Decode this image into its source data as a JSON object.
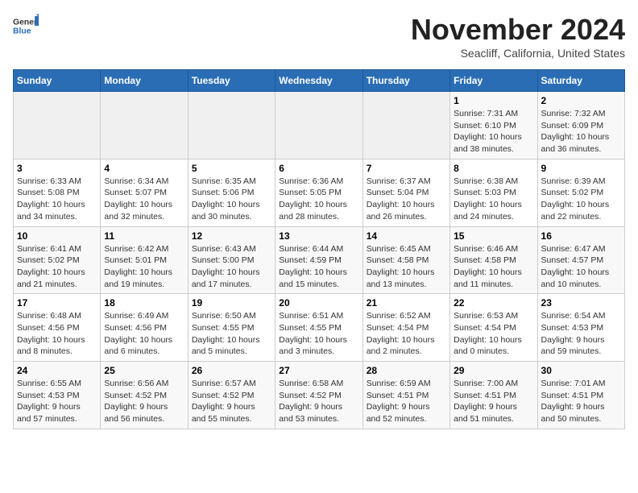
{
  "header": {
    "logo_general": "General",
    "logo_blue": "Blue",
    "month_title": "November 2024",
    "location": "Seacliff, California, United States"
  },
  "weekdays": [
    "Sunday",
    "Monday",
    "Tuesday",
    "Wednesday",
    "Thursday",
    "Friday",
    "Saturday"
  ],
  "weeks": [
    [
      {
        "day": "",
        "info": ""
      },
      {
        "day": "",
        "info": ""
      },
      {
        "day": "",
        "info": ""
      },
      {
        "day": "",
        "info": ""
      },
      {
        "day": "",
        "info": ""
      },
      {
        "day": "1",
        "info": "Sunrise: 7:31 AM\nSunset: 6:10 PM\nDaylight: 10 hours\nand 38 minutes."
      },
      {
        "day": "2",
        "info": "Sunrise: 7:32 AM\nSunset: 6:09 PM\nDaylight: 10 hours\nand 36 minutes."
      }
    ],
    [
      {
        "day": "3",
        "info": "Sunrise: 6:33 AM\nSunset: 5:08 PM\nDaylight: 10 hours\nand 34 minutes."
      },
      {
        "day": "4",
        "info": "Sunrise: 6:34 AM\nSunset: 5:07 PM\nDaylight: 10 hours\nand 32 minutes."
      },
      {
        "day": "5",
        "info": "Sunrise: 6:35 AM\nSunset: 5:06 PM\nDaylight: 10 hours\nand 30 minutes."
      },
      {
        "day": "6",
        "info": "Sunrise: 6:36 AM\nSunset: 5:05 PM\nDaylight: 10 hours\nand 28 minutes."
      },
      {
        "day": "7",
        "info": "Sunrise: 6:37 AM\nSunset: 5:04 PM\nDaylight: 10 hours\nand 26 minutes."
      },
      {
        "day": "8",
        "info": "Sunrise: 6:38 AM\nSunset: 5:03 PM\nDaylight: 10 hours\nand 24 minutes."
      },
      {
        "day": "9",
        "info": "Sunrise: 6:39 AM\nSunset: 5:02 PM\nDaylight: 10 hours\nand 22 minutes."
      }
    ],
    [
      {
        "day": "10",
        "info": "Sunrise: 6:41 AM\nSunset: 5:02 PM\nDaylight: 10 hours\nand 21 minutes."
      },
      {
        "day": "11",
        "info": "Sunrise: 6:42 AM\nSunset: 5:01 PM\nDaylight: 10 hours\nand 19 minutes."
      },
      {
        "day": "12",
        "info": "Sunrise: 6:43 AM\nSunset: 5:00 PM\nDaylight: 10 hours\nand 17 minutes."
      },
      {
        "day": "13",
        "info": "Sunrise: 6:44 AM\nSunset: 4:59 PM\nDaylight: 10 hours\nand 15 minutes."
      },
      {
        "day": "14",
        "info": "Sunrise: 6:45 AM\nSunset: 4:58 PM\nDaylight: 10 hours\nand 13 minutes."
      },
      {
        "day": "15",
        "info": "Sunrise: 6:46 AM\nSunset: 4:58 PM\nDaylight: 10 hours\nand 11 minutes."
      },
      {
        "day": "16",
        "info": "Sunrise: 6:47 AM\nSunset: 4:57 PM\nDaylight: 10 hours\nand 10 minutes."
      }
    ],
    [
      {
        "day": "17",
        "info": "Sunrise: 6:48 AM\nSunset: 4:56 PM\nDaylight: 10 hours\nand 8 minutes."
      },
      {
        "day": "18",
        "info": "Sunrise: 6:49 AM\nSunset: 4:56 PM\nDaylight: 10 hours\nand 6 minutes."
      },
      {
        "day": "19",
        "info": "Sunrise: 6:50 AM\nSunset: 4:55 PM\nDaylight: 10 hours\nand 5 minutes."
      },
      {
        "day": "20",
        "info": "Sunrise: 6:51 AM\nSunset: 4:55 PM\nDaylight: 10 hours\nand 3 minutes."
      },
      {
        "day": "21",
        "info": "Sunrise: 6:52 AM\nSunset: 4:54 PM\nDaylight: 10 hours\nand 2 minutes."
      },
      {
        "day": "22",
        "info": "Sunrise: 6:53 AM\nSunset: 4:54 PM\nDaylight: 10 hours\nand 0 minutes."
      },
      {
        "day": "23",
        "info": "Sunrise: 6:54 AM\nSunset: 4:53 PM\nDaylight: 9 hours\nand 59 minutes."
      }
    ],
    [
      {
        "day": "24",
        "info": "Sunrise: 6:55 AM\nSunset: 4:53 PM\nDaylight: 9 hours\nand 57 minutes."
      },
      {
        "day": "25",
        "info": "Sunrise: 6:56 AM\nSunset: 4:52 PM\nDaylight: 9 hours\nand 56 minutes."
      },
      {
        "day": "26",
        "info": "Sunrise: 6:57 AM\nSunset: 4:52 PM\nDaylight: 9 hours\nand 55 minutes."
      },
      {
        "day": "27",
        "info": "Sunrise: 6:58 AM\nSunset: 4:52 PM\nDaylight: 9 hours\nand 53 minutes."
      },
      {
        "day": "28",
        "info": "Sunrise: 6:59 AM\nSunset: 4:51 PM\nDaylight: 9 hours\nand 52 minutes."
      },
      {
        "day": "29",
        "info": "Sunrise: 7:00 AM\nSunset: 4:51 PM\nDaylight: 9 hours\nand 51 minutes."
      },
      {
        "day": "30",
        "info": "Sunrise: 7:01 AM\nSunset: 4:51 PM\nDaylight: 9 hours\nand 50 minutes."
      }
    ]
  ]
}
